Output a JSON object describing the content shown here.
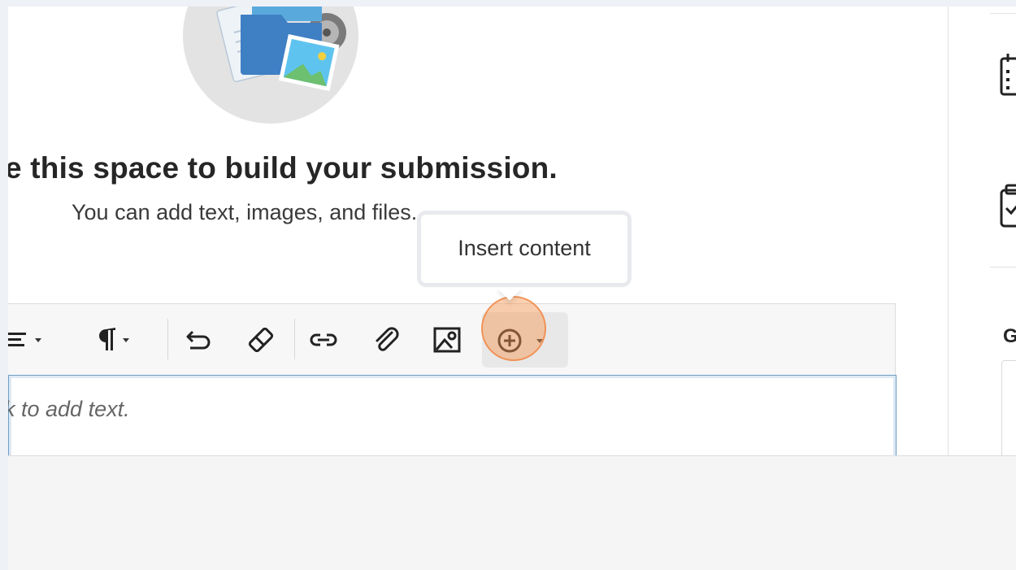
{
  "empty_state": {
    "heading": "e this space to build your submission.",
    "subtext": "You can add text, images, and files."
  },
  "tooltip": {
    "text": "Insert content"
  },
  "toolbar": {
    "buttons": [
      {
        "name": "align-menu",
        "icon": "align-left-icon"
      },
      {
        "name": "paragraph-menu",
        "icon": "paragraph-icon"
      },
      {
        "name": "undo",
        "icon": "undo-icon"
      },
      {
        "name": "clear-formatting",
        "icon": "eraser-icon"
      },
      {
        "name": "insert-link",
        "icon": "link-icon"
      },
      {
        "name": "attach-file",
        "icon": "paperclip-icon"
      },
      {
        "name": "insert-image",
        "icon": "image-icon"
      },
      {
        "name": "insert-content",
        "icon": "plus-circle-icon"
      }
    ]
  },
  "editor": {
    "placeholder": "k to add text."
  },
  "right_panel": {
    "section_initial": "G"
  }
}
